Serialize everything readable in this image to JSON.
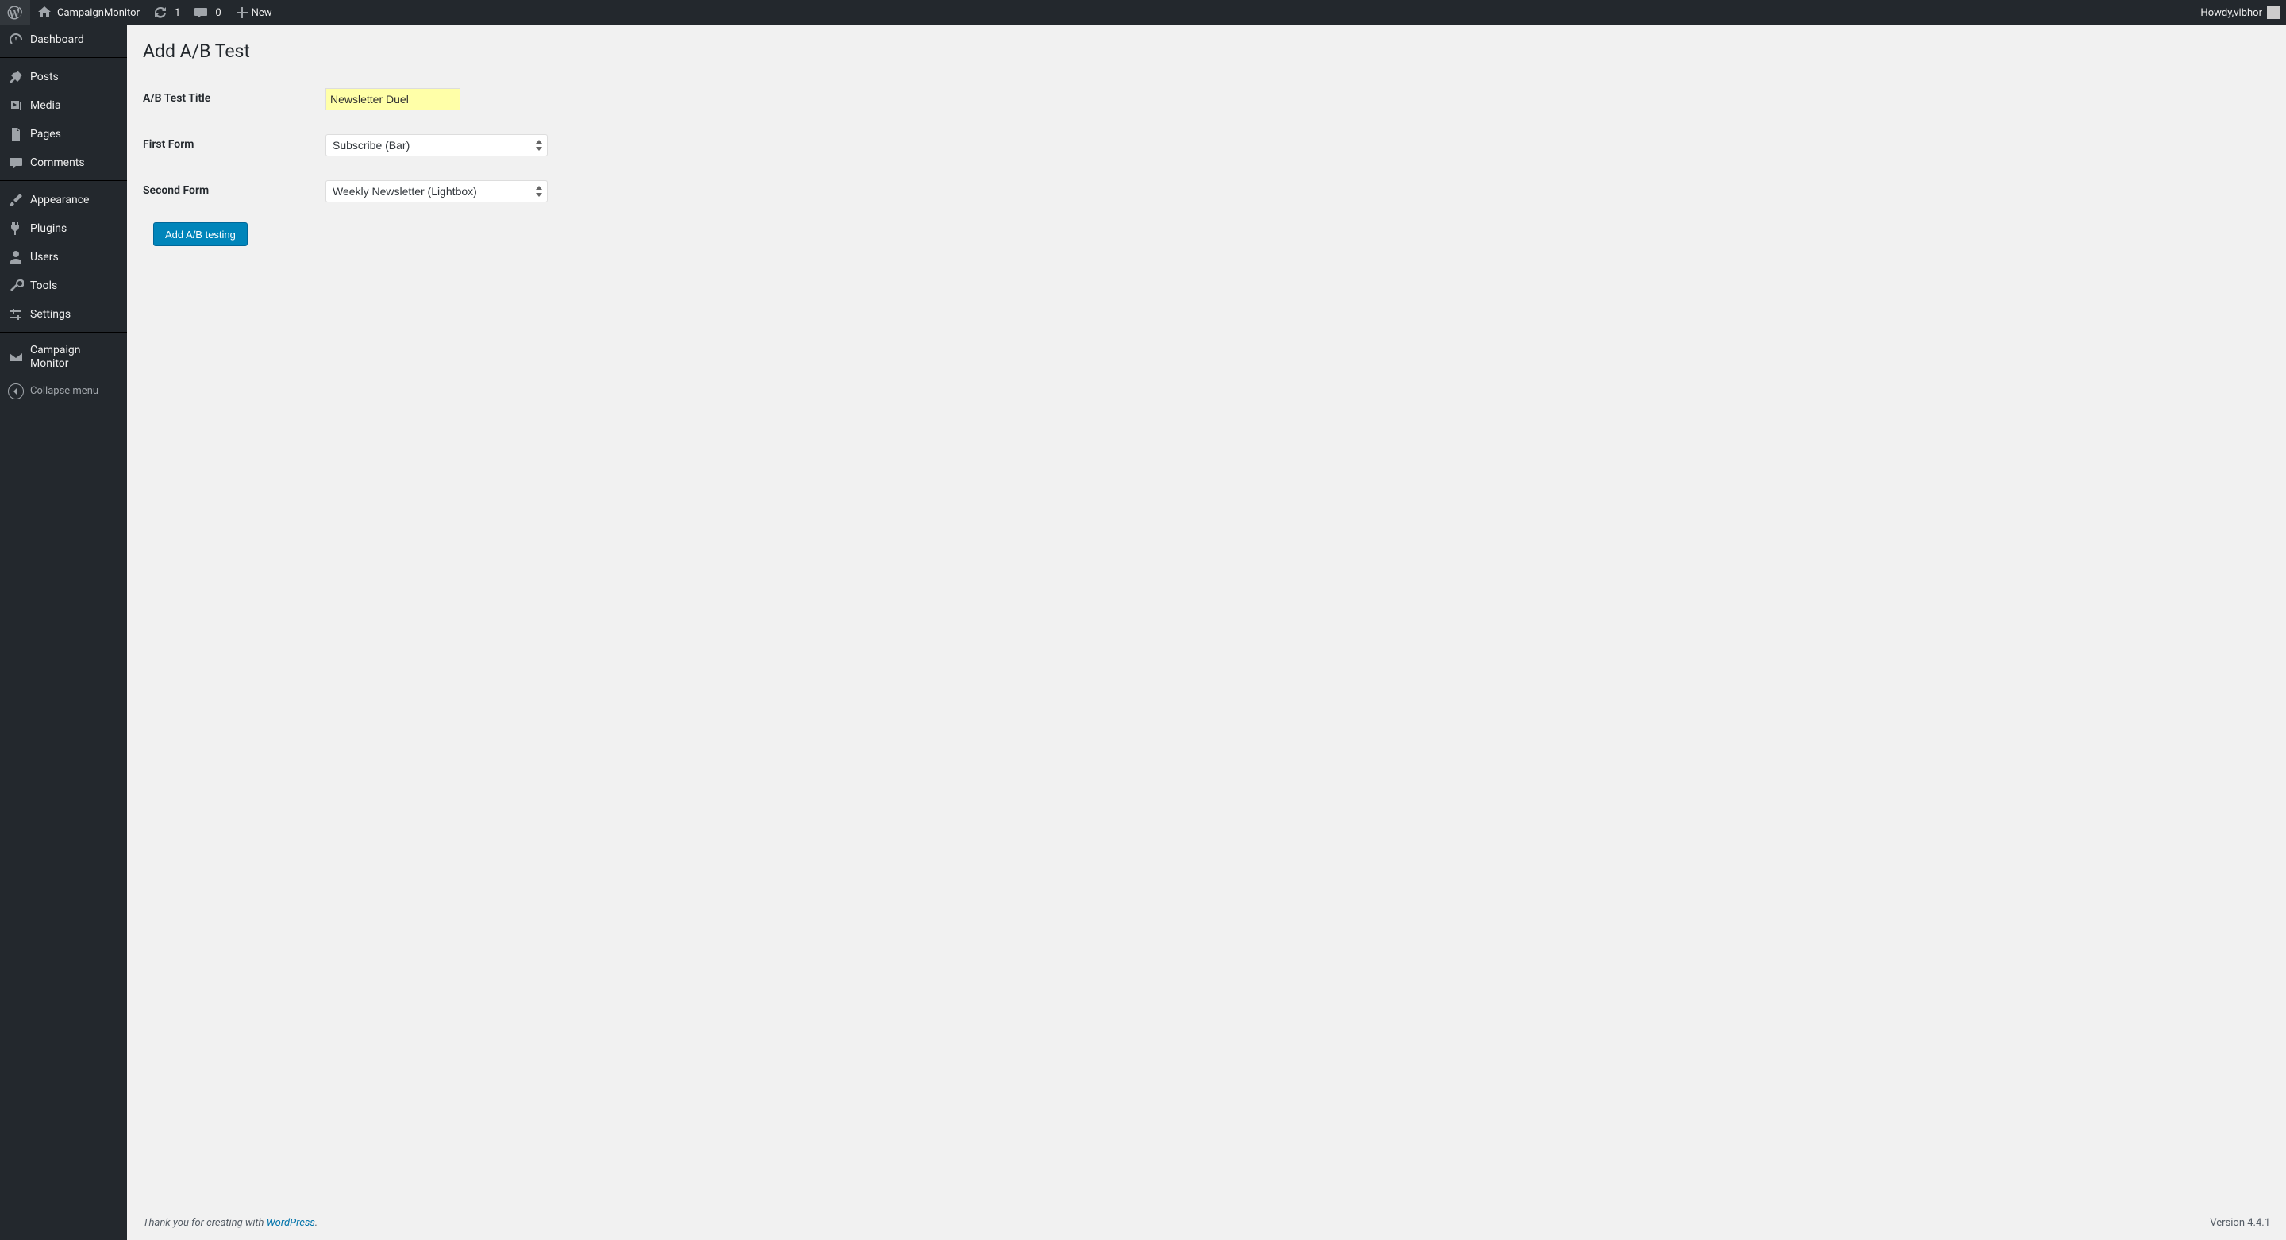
{
  "adminbar": {
    "site_name": "CampaignMonitor",
    "updates_count": "1",
    "comments_count": "0",
    "new_label": "New",
    "howdy_prefix": "Howdy, ",
    "user_name": "vibhor"
  },
  "sidebar": {
    "items": [
      {
        "id": "dashboard",
        "label": "Dashboard",
        "icon": "dashboard"
      },
      {
        "separator": true
      },
      {
        "id": "posts",
        "label": "Posts",
        "icon": "pin"
      },
      {
        "id": "media",
        "label": "Media",
        "icon": "media"
      },
      {
        "id": "pages",
        "label": "Pages",
        "icon": "page"
      },
      {
        "id": "comments",
        "label": "Comments",
        "icon": "comment"
      },
      {
        "separator": true
      },
      {
        "id": "appearance",
        "label": "Appearance",
        "icon": "brush"
      },
      {
        "id": "plugins",
        "label": "Plugins",
        "icon": "plug"
      },
      {
        "id": "users",
        "label": "Users",
        "icon": "user"
      },
      {
        "id": "tools",
        "label": "Tools",
        "icon": "wrench"
      },
      {
        "id": "settings",
        "label": "Settings",
        "icon": "sliders"
      },
      {
        "separator": true
      },
      {
        "id": "campaign-monitor",
        "label": "Campaign Monitor",
        "icon": "envelope"
      }
    ],
    "collapse_label": "Collapse menu"
  },
  "page": {
    "title": "Add A/B Test",
    "fields": {
      "title": {
        "label": "A/B Test Title",
        "value": "Newsletter Duel"
      },
      "first_form": {
        "label": "First Form",
        "selected": "Subscribe (Bar)"
      },
      "second_form": {
        "label": "Second Form",
        "selected": "Weekly Newsletter (Lightbox)"
      }
    },
    "submit_label": "Add A/B testing"
  },
  "footer": {
    "thankyou_prefix": "Thank you for creating with ",
    "thankyou_link_text": "WordPress",
    "thankyou_suffix": ".",
    "version_text": "Version 4.4.1"
  }
}
